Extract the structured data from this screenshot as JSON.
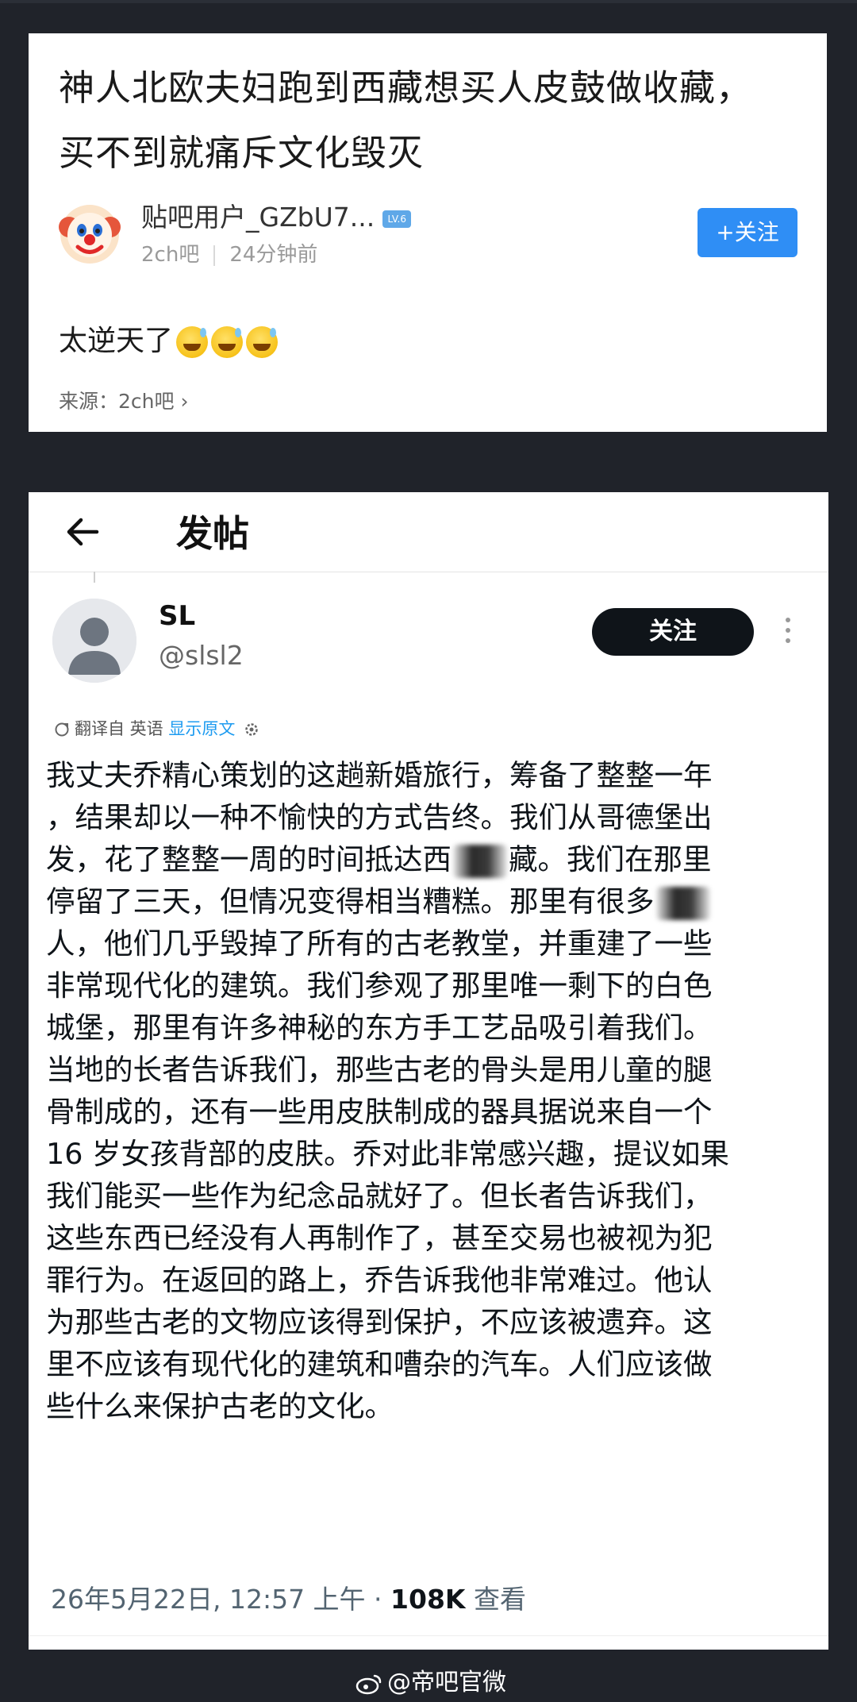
{
  "top_post": {
    "title_line1": "神人北欧夫妇跑到西藏想买人皮鼓做收藏，",
    "title_line2": "买不到就痛斥文化毁灭",
    "username": "贴吧用户_GZbU7...",
    "level_badge": "LV.6",
    "forum": "2ch吧",
    "time": "24分钟前",
    "follow_label": "+关注",
    "body_text": "太逆天了",
    "emoji_name": "sweat-smile-emoji",
    "source_label": "来源：2ch吧 ›",
    "accent_color": "#2f8ef5"
  },
  "tweet": {
    "header_title": "发帖",
    "display_name": "SL",
    "handle": "@slsl2",
    "follow_label": "关注",
    "translate_label": "翻译自 英语",
    "show_original_label": "显示原文",
    "lines": [
      "我丈夫乔精心策划的这趟新婚旅行，筹备了整整一年",
      "，结果却以一种不愉快的方式告终。我们从哥德堡出",
      "发，花了整整一周的时间抵达西",
      "藏",
      "。我们在那里",
      "停留了三天，但情况变得相当糟糕。那里有很多",
      "人，他们几乎毁掉了所有的古老教堂，并重建了一些",
      "非常现代化的建筑。我们参观了那里唯一剩下的白色",
      "城堡，那里有许多神秘的东方手工艺品吸引着我们。",
      "当地的长者告诉我们，那些古老的骨头是用儿童的腿",
      "骨制成的，还有一些用皮肤制成的器具据说来自一个",
      "16 岁女孩背部的皮肤。乔对此非常感兴趣，提议如果",
      "我们能买一些作为纪念品就好了。但长者告诉我们，",
      "这些东西已经没有人再制作了，甚至交易也被视为犯",
      "罪行为。在返回的路上，乔告诉我他非常难过。他认",
      "为那些古老的文物应该得到保护，不应该被遗弃。这",
      "里不应该有现代化的建筑和嘈杂的汽车。人们应该做",
      "些什么来保护古老的文化。"
    ],
    "timestamp": "26年5月22日, 12:57 上午 · ",
    "views_count": "108K",
    "views_label": " 查看"
  },
  "watermark": {
    "text": "@帝吧官微"
  }
}
